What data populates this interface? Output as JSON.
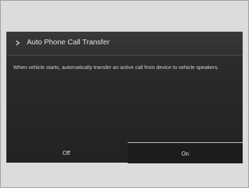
{
  "setting": {
    "title": "Auto Phone Call Transfer",
    "description": "When vehicle starts, automatically transfer an active call from device to vehicle speakers.",
    "back_icon": "chevron-right-icon"
  },
  "options": [
    {
      "label": "Off",
      "selected": false
    },
    {
      "label": "On",
      "selected": true
    }
  ],
  "colors": {
    "screen_background": "#2a2a2a",
    "text": "#e6e6e6",
    "selected_highlight": "#cfcfcf"
  }
}
